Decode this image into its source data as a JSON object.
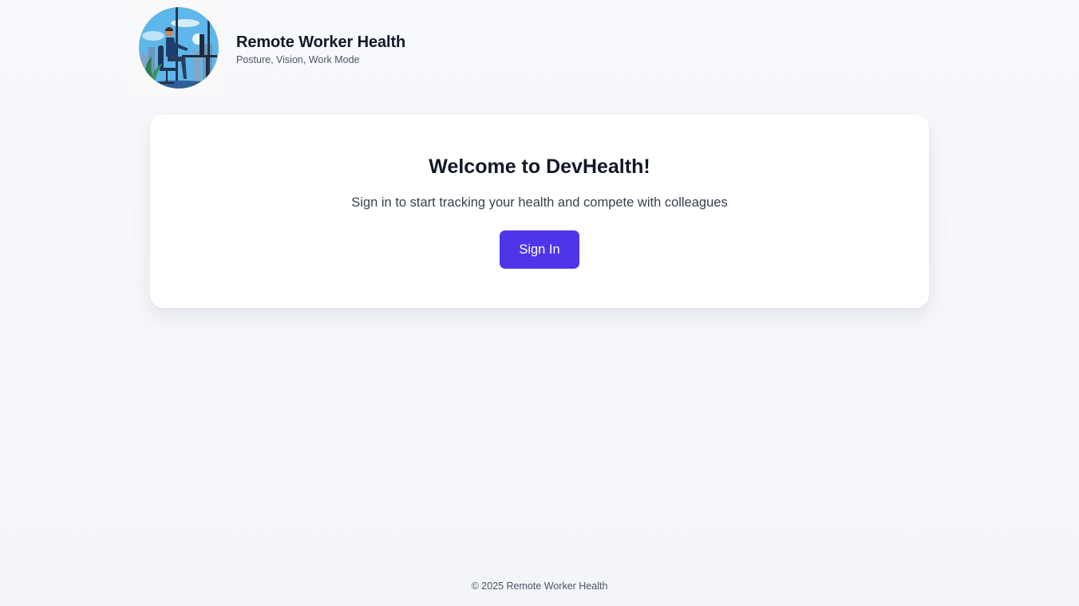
{
  "header": {
    "logo_icon": "remote-worker-at-desk-illustration",
    "title": "Remote Worker Health",
    "subtitle": "Posture, Vision, Work Mode"
  },
  "welcome": {
    "title": "Welcome to DevHealth!",
    "subtitle": "Sign in to start tracking your health and compete with colleagues",
    "signin_label": "Sign In"
  },
  "footer": {
    "copyright": "© 2025 Remote Worker Health"
  },
  "colors": {
    "accent": "#4f35ea",
    "background": "#f6f7fb",
    "card": "#ffffff",
    "text_primary": "#111827",
    "text_secondary": "#4b5563"
  }
}
